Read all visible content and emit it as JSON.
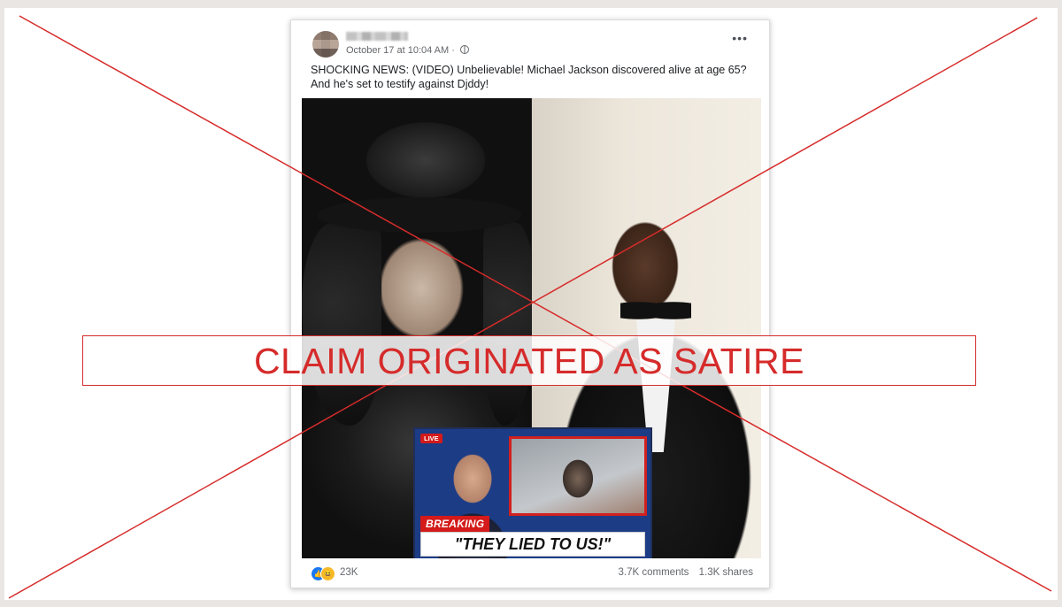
{
  "post": {
    "timestamp": "October 17 at 10:04 AM · ",
    "more_label": "•••",
    "caption": "SHOCKING NEWS: (VIDEO) Unbelievable! Michael Jackson discovered alive at age 65? And he's set to testify against Djddy!"
  },
  "thumbnail": {
    "live_badge": "LIVE",
    "breaking_label": "BREAKING",
    "headline": "\"THEY LIED TO US!\""
  },
  "engagement": {
    "reactions": "23K",
    "comments": "3.7K comments",
    "shares": "1.3K shares"
  },
  "overlay": {
    "verdict": "CLAIM ORIGINATED AS SATIRE",
    "color": "#d62b2b"
  }
}
